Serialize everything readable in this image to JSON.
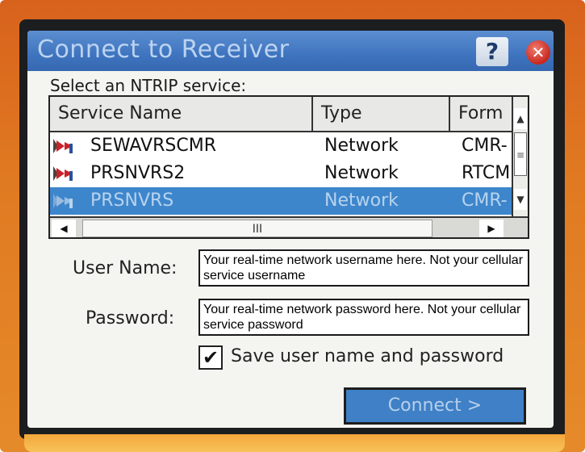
{
  "window": {
    "title": "Connect to Receiver",
    "help_label": "?",
    "close_label": "✕"
  },
  "prompt": "Select an NTRIP service:",
  "table": {
    "columns": [
      "Service Name",
      "Type",
      "Form"
    ],
    "rows": [
      {
        "name": "SEWAVRSCMR",
        "type": "Network",
        "format": "CMR-",
        "selected": false
      },
      {
        "name": "PRSNVRS2",
        "type": "Network",
        "format": "RTCM",
        "selected": false
      },
      {
        "name": "PRSNVRS",
        "type": "Network",
        "format": "CMR-",
        "selected": true
      }
    ],
    "scroll_up": "▲",
    "scroll_down": "▼",
    "scroll_left": "◀",
    "scroll_right": "▶",
    "vthumb_grip": "≡",
    "hthumb_grip": "III"
  },
  "form": {
    "username_label": "User Name:",
    "username_value": "Your real-time network username here. Not your cellular service username",
    "password_label": "Password:",
    "password_value": "Your real-time network password here. Not your cellular service password",
    "save_checked_mark": "✔",
    "save_label": "Save user name and password"
  },
  "connect_button": "Connect >",
  "colors": {
    "titlebar": "#3f74bf",
    "selection": "#3e86cc",
    "device": "#e07a22"
  }
}
